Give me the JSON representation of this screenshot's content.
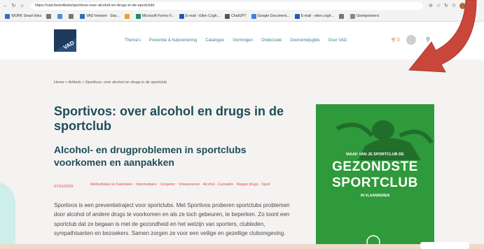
{
  "browser": {
    "url": "https://vad.be/artikels/sportivos-over-alcohol-en-drugs-in-de-sportclub/",
    "bookmarks": [
      {
        "label": "WORK Smart links",
        "color": "#3a6cc4"
      },
      {
        "label": "",
        "color": "#777777"
      },
      {
        "label": "",
        "color": "#4a90d9"
      },
      {
        "label": "",
        "color": "#777777"
      },
      {
        "label": "VAD Intranet - Star...",
        "color": "#2f6fb5"
      },
      {
        "label": "",
        "color": "#e8a12a"
      },
      {
        "label": "Microsoft Forms-V...",
        "color": "#1f8a6b"
      },
      {
        "label": "E-mail - Ellen Cogh...",
        "color": "#1f5bb5"
      },
      {
        "label": "ChatGPT",
        "color": "#555555"
      },
      {
        "label": "Google Document...",
        "color": "#3f7de0"
      },
      {
        "label": "E-mail - ellen.cogh...",
        "color": "#1f5bb5"
      },
      {
        "label": "",
        "color": "#777777"
      },
      {
        "label": "Geimporteerd",
        "color": "#888888"
      }
    ]
  },
  "header": {
    "logo_text": "VAD",
    "menu": [
      "Thema's",
      "Preventie & hulpverlening",
      "Catalogus",
      "Vormingen",
      "Onderzoek",
      "Doorverwijsgids",
      "Over VAD"
    ],
    "cart": "0"
  },
  "article": {
    "breadcrumb": "Home > Artikels > Sportivos: over alcohol en drugs in de sportclub",
    "title": "Sportivos: over alcohol en drugs in de sportclub",
    "subtitle": "Alcohol- en drugproblemen in sportclubs voorkomen en aanpakken",
    "date": "07/01/2025",
    "tags": "Methodieken & materialen · Intermediairs · Jongeren · Volwassenen · Alcohol · Cannabis · Illegale drugs · Sport",
    "intro": "Sportivos is een preventietraject voor sportclubs. Met Sportivos proberen sportclubs problemen door alcohol of andere drugs te voorkomen en als ze toch gebeuren, te beperken. Zo toont een sportclub dat ze begaan is met de gezondheid en het welzijn van sporters, clubleden, sympathisanten en bezoekers. Samen zorgen ze voor een veilige en gezellige clubomgeving."
  },
  "promo": {
    "tagline": "MAAK VAN JE SPORTCLUB DE",
    "line1": "GEZONDSTE",
    "line2": "SPORTCLUB",
    "region": "IN VLAANDEREN",
    "color": "#2e9a3b"
  }
}
